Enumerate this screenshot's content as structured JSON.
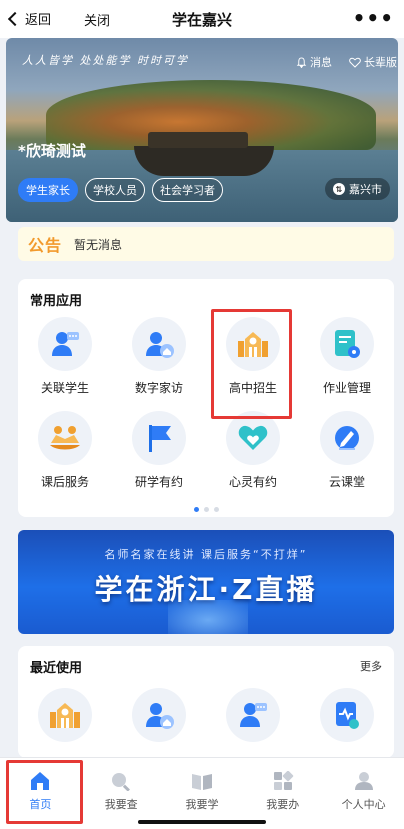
{
  "header": {
    "back_label": "返回",
    "close_label": "关闭",
    "title": "学在嘉兴",
    "more_label": "•••"
  },
  "hero": {
    "slogan": "人人皆学 处处能学 时时可学",
    "messages_label": "消息",
    "elder_label": "长辈版",
    "user_name": "*欣琦测试",
    "roles": [
      "学生家长",
      "学校人员",
      "社会学习者"
    ],
    "active_role_index": 0,
    "city": "嘉兴市"
  },
  "notice": {
    "tag": "公告",
    "text": "暂无消息"
  },
  "common_apps": {
    "title": "常用应用",
    "items": [
      {
        "label": "关联学生",
        "icon": "student-link-icon"
      },
      {
        "label": "数字家访",
        "icon": "home-visit-icon"
      },
      {
        "label": "高中招生",
        "icon": "school-enroll-icon"
      },
      {
        "label": "作业管理",
        "icon": "homework-icon"
      },
      {
        "label": "课后服务",
        "icon": "after-school-icon"
      },
      {
        "label": "研学有约",
        "icon": "flag-icon"
      },
      {
        "label": "心灵有约",
        "icon": "heart-icon"
      },
      {
        "label": "云课堂",
        "icon": "cloud-class-icon"
      }
    ],
    "page_count": 3,
    "current_page": 0
  },
  "banner": {
    "subtitle": "名师名家在线讲 课后服务“不打烊”",
    "title": "学在浙江·Z直播"
  },
  "recent": {
    "title": "最近使用",
    "more_label": "更多",
    "items": [
      "school-enroll-icon",
      "home-visit-icon",
      "student-link-icon",
      "health-check-icon"
    ]
  },
  "bottom_nav": {
    "items": [
      {
        "label": "首页",
        "icon": "home-icon"
      },
      {
        "label": "我要查",
        "icon": "search-icon"
      },
      {
        "label": "我要学",
        "icon": "book-icon"
      },
      {
        "label": "我要办",
        "icon": "apps-icon"
      },
      {
        "label": "个人中心",
        "icon": "profile-icon"
      }
    ],
    "active_index": 0
  },
  "colors": {
    "accent": "#2f7cf6",
    "highlight": "#e53935",
    "notice_tag": "#f29a2c"
  }
}
